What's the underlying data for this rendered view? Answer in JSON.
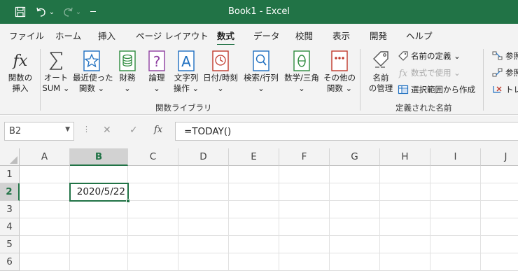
{
  "titlebar": {
    "title": "Book1 - Excel",
    "undo_dropdown": "⌄",
    "redo_dropdown": "⌄",
    "customize": "⌄",
    "accent": "#217346"
  },
  "tabs": [
    {
      "label": "ファイル"
    },
    {
      "label": "ホーム"
    },
    {
      "label": "挿入"
    },
    {
      "label": "ページ レイアウト"
    },
    {
      "label": "数式",
      "active": true
    },
    {
      "label": "データ"
    },
    {
      "label": "校閲"
    },
    {
      "label": "表示"
    },
    {
      "label": "開発"
    },
    {
      "label": "ヘルプ"
    }
  ],
  "ribbon": {
    "function_library": {
      "group_label": "関数ライブラリ",
      "buttons": [
        {
          "line1": "関数の",
          "line2": "挿入",
          "icon": "fx-icon"
        },
        {
          "line1": "オート",
          "line2": "SUM ⌄",
          "icon": "sigma-icon"
        },
        {
          "line1": "最近使った",
          "line2": "関数 ⌄",
          "icon": "star-icon"
        },
        {
          "line1": "財務",
          "line2": "⌄",
          "icon": "coins-icon"
        },
        {
          "line1": "論理",
          "line2": "⌄",
          "icon": "question-book-icon"
        },
        {
          "line1": "文字列",
          "line2": "操作 ⌄",
          "icon": "text-book-icon"
        },
        {
          "line1": "日付/時刻",
          "line2": "⌄",
          "icon": "clock-book-icon"
        },
        {
          "line1": "検索/行列",
          "line2": "⌄",
          "icon": "search-book-icon"
        },
        {
          "line1": "数学/三角",
          "line2": "⌄",
          "icon": "theta-book-icon"
        },
        {
          "line1": "その他の",
          "line2": "関数 ⌄",
          "icon": "more-book-icon"
        }
      ]
    },
    "defined_names": {
      "group_label": "定義された名前",
      "name_manager": {
        "line1": "名前",
        "line2": "の管理"
      },
      "define_name": "名前の定義 ⌄",
      "use_in_formula": "数式で使用 ⌄",
      "create_from_selection": "選択範囲から作成"
    },
    "auditing": {
      "trace_precedents": "参照",
      "trace_dependents": "参照",
      "remove_arrows": "トレ"
    }
  },
  "formula_bar": {
    "name_box": "B2",
    "name_box_dropdown": "▼",
    "cancel": "✕",
    "enter": "✓",
    "fx": "fx",
    "formula": "=TODAY()"
  },
  "grid": {
    "columns": [
      "A",
      "B",
      "C",
      "D",
      "E",
      "F",
      "G",
      "H",
      "I",
      "J"
    ],
    "rows": [
      "1",
      "2",
      "3",
      "4",
      "5",
      "6"
    ],
    "selected_column": "B",
    "selected_row": "2",
    "cells": {
      "B2": "2020/5/22"
    }
  }
}
